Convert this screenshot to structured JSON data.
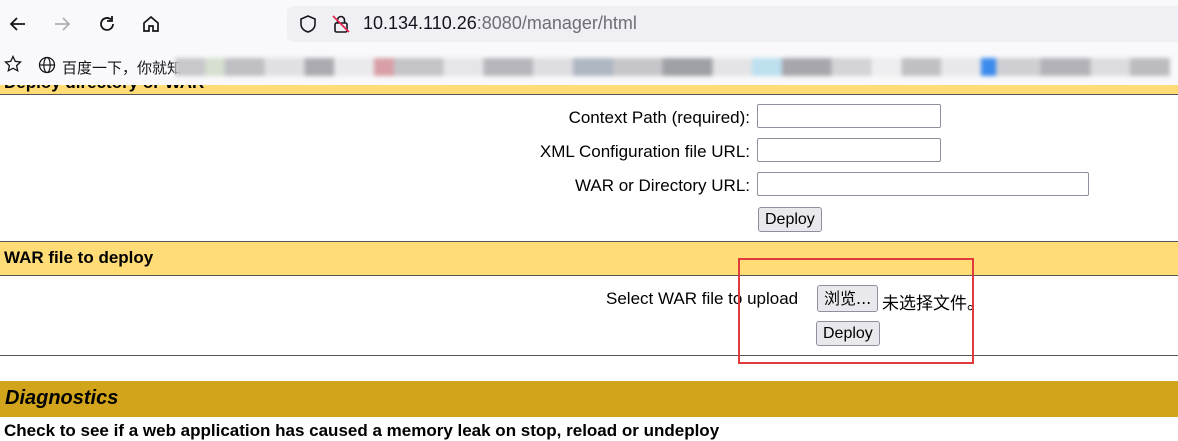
{
  "browser": {
    "url_host": "10.134.110.26",
    "url_rest": ":8080/manager/html",
    "bookmark_label": "百度一下，你就知"
  },
  "deploy_directory": {
    "title": "Deploy directory or WAR",
    "context_path_label": "Context Path (required):",
    "context_path_value": "",
    "xml_config_label": "XML Configuration file URL:",
    "xml_config_value": "",
    "war_dir_label": "WAR or Directory URL:",
    "war_dir_value": "",
    "deploy_button": "Deploy"
  },
  "war_upload": {
    "title": "WAR file to deploy",
    "select_label": "Select WAR file to upload",
    "browse_button": "浏览...",
    "no_file_text": "未选择文件。",
    "deploy_button": "Deploy"
  },
  "diagnostics": {
    "title": "Diagnostics",
    "description": "Check to see if a web application has caused a memory leak on stop, reload or undeploy"
  },
  "colors": {
    "section_header": "#ffdc75",
    "diagnostics_header": "#d2a41c",
    "highlight_box": "#e0393e"
  }
}
